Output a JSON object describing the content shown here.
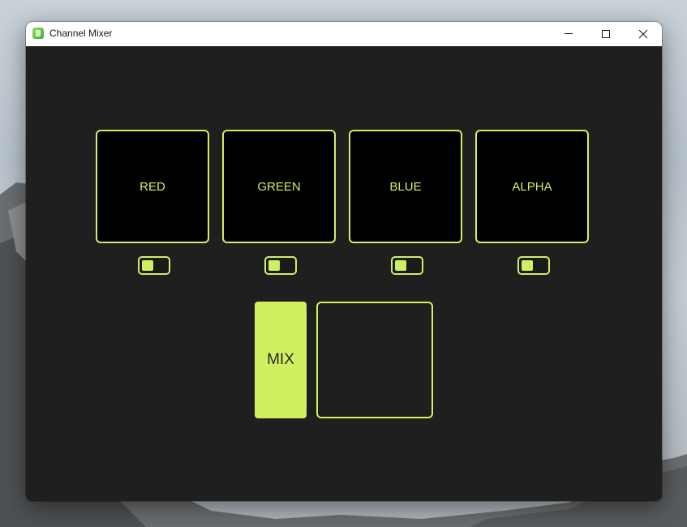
{
  "window": {
    "title": "Channel Mixer",
    "icon": "app-icon-green"
  },
  "caption_buttons": {
    "minimize_icon": "minimize-icon",
    "maximize_icon": "maximize-icon",
    "close_icon": "close-icon"
  },
  "channels": [
    {
      "label": "RED",
      "toggle_on": false
    },
    {
      "label": "GREEN",
      "toggle_on": false
    },
    {
      "label": "BLUE",
      "toggle_on": false
    },
    {
      "label": "ALPHA",
      "toggle_on": false
    }
  ],
  "mix": {
    "label": "MIX",
    "output_value": ""
  },
  "colors": {
    "accent": "#d0f060",
    "background": "#1f1f1f",
    "tile": "#000000",
    "titlebar": "#ffffff"
  }
}
